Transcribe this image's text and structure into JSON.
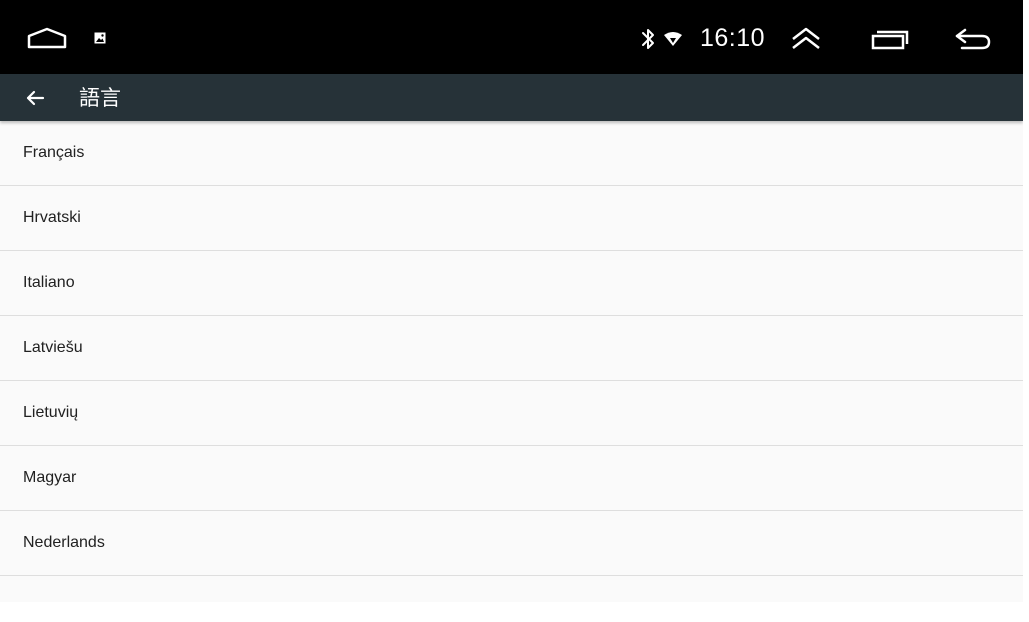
{
  "status_bar": {
    "time": "16:10",
    "icons": [
      "home-icon",
      "image-notification-icon",
      "bluetooth-icon",
      "wifi-icon",
      "expand-up-icon",
      "recent-apps-icon",
      "back-nav-icon"
    ],
    "background": "#000000"
  },
  "app_bar": {
    "title": "語言",
    "back_icon": "arrow-left-icon",
    "background": "#263238"
  },
  "languages": [
    "Français",
    "Hrvatski",
    "Italiano",
    "Latviešu",
    "Lietuvių",
    "Magyar",
    "Nederlands"
  ]
}
